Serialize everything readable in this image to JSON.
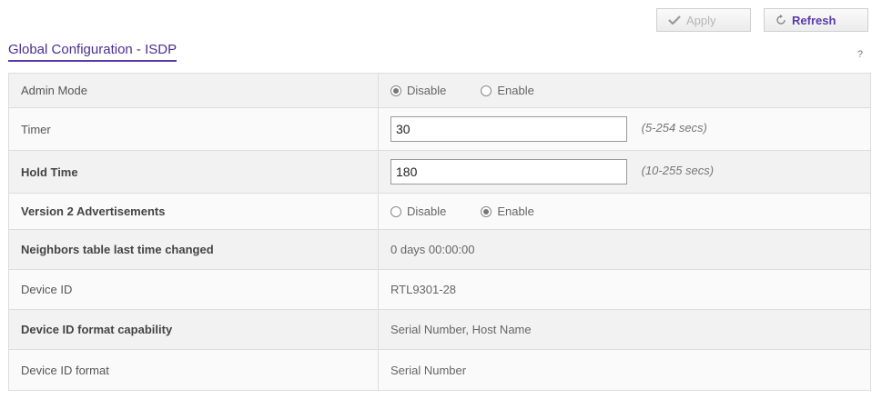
{
  "toolbar": {
    "apply_label": "Apply",
    "refresh_label": "Refresh"
  },
  "section": {
    "title": "Global Configuration - ISDP",
    "help": "?"
  },
  "rows": {
    "admin_mode": {
      "label": "Admin Mode",
      "options": [
        "Disable",
        "Enable"
      ],
      "selected": "Disable"
    },
    "timer": {
      "label": "Timer",
      "value": "30",
      "hint": "(5-254 secs)"
    },
    "hold_time": {
      "label": "Hold Time",
      "value": "180",
      "hint": "(10-255 secs)"
    },
    "version2": {
      "label": "Version 2 Advertisements",
      "options": [
        "Disable",
        "Enable"
      ],
      "selected": "Enable"
    },
    "neighbors_changed": {
      "label": "Neighbors table last time changed",
      "value": "0 days 00:00:00"
    },
    "device_id": {
      "label": "Device ID",
      "value": "RTL9301-28"
    },
    "device_id_capability": {
      "label": "Device ID format capability",
      "value": "Serial Number, Host Name"
    },
    "device_id_format": {
      "label": "Device ID format",
      "value": "Serial Number"
    }
  }
}
